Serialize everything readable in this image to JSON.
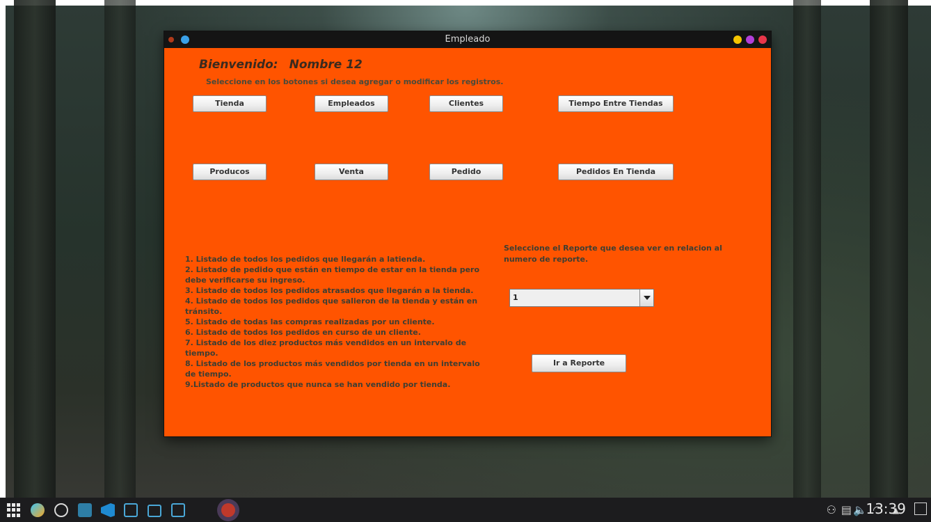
{
  "window": {
    "title": "Empleado"
  },
  "header": {
    "welcome_label": "Bienvenido:",
    "user_name": "Nombre 12",
    "instruction": "Seleccione en los botones si desea agregar o modificar los registros."
  },
  "buttons": {
    "tienda": "Tienda",
    "empleados": "Empleados",
    "clientes": "Clientes",
    "tiempo_entre_tiendas": "Tiempo Entre Tiendas",
    "producos": "Producos",
    "venta": "Venta",
    "pedido": "Pedido",
    "pedidos_en_tienda": "Pedidos En Tienda",
    "ir_a_reporte": "Ir a Reporte"
  },
  "reports": {
    "lines": [
      "1. Listado de todos los pedidos que llegarán a latienda.",
      "2. Listado de pedido que están en tiempo de estar en la tienda pero",
      "debe verificarse su ingreso.",
      "3. Listado de todos los pedidos atrasados que llegarán a la tienda.",
      "4. Listado de todos los pedidos que salieron de la tienda y están en",
      "tránsito.",
      "5. Listado de todas las compras realizadas por un cliente.",
      "6. Listado de todos los pedidos en curso de un cliente.",
      "7. Listado de los diez productos más vendidos en un intervalo de",
      "tiempo.",
      "8. Listado de los productos más vendidos por tienda en un intervalo",
      "de tiempo.",
      "9.Listado de productos que nunca se han vendido por tienda."
    ],
    "prompt_line1": "Seleccione el Reporte que desea ver en relacion al",
    "prompt_line2": "numero de reporte.",
    "selected_value": "1"
  },
  "taskbar": {
    "clock": "13:39"
  },
  "colors": {
    "window_bg": "#ff5400",
    "titlebar_bg": "#141414"
  }
}
